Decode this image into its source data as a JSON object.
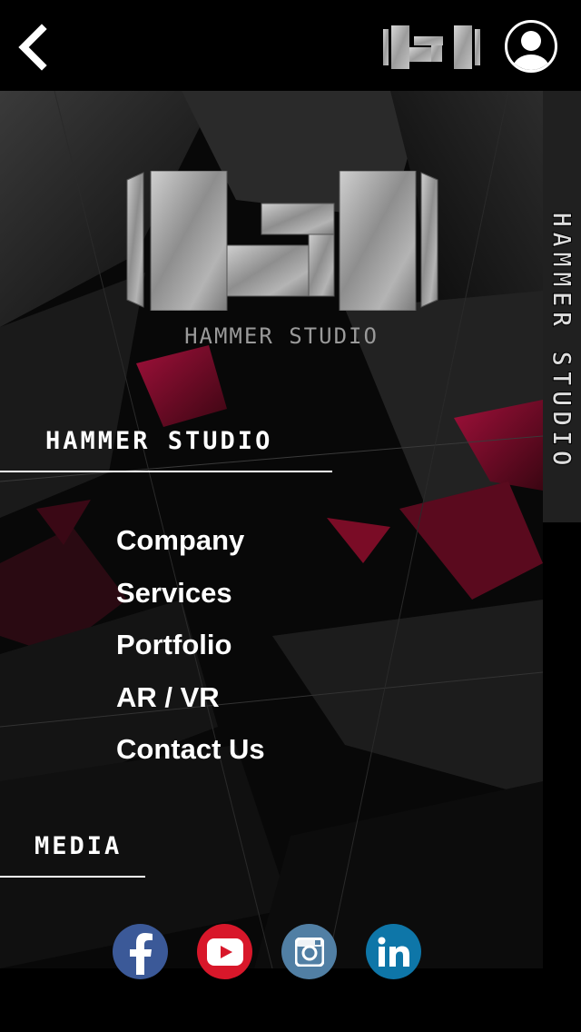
{
  "header": {
    "back_icon": "chevron-left-icon",
    "logo_icon": "hammer-studio-logo",
    "profile_icon": "user-profile-icon"
  },
  "brand": {
    "logo_caption": "HAMMER STUDIO",
    "side_title": "HAMMER STUDIO"
  },
  "sections": {
    "studio_title": "HAMMER STUDIO",
    "media_title": "MEDIA"
  },
  "menu": {
    "items": [
      {
        "label": "Company"
      },
      {
        "label": "Services"
      },
      {
        "label": "Portfolio"
      },
      {
        "label": "AR / VR"
      },
      {
        "label": "Contact Us"
      }
    ]
  },
  "social": {
    "items": [
      {
        "name": "facebook",
        "icon": "facebook-icon",
        "color": "#3b5998"
      },
      {
        "name": "youtube",
        "icon": "youtube-icon",
        "color": "#d8172a"
      },
      {
        "name": "instagram",
        "icon": "instagram-icon",
        "color": "#517fa4"
      },
      {
        "name": "linkedin",
        "icon": "linkedin-icon",
        "color": "#0e76a8"
      }
    ]
  },
  "colors": {
    "background": "#000000",
    "accent_red": "#8a0f2a",
    "text": "#ffffff",
    "logo_grey": "#9a9a9a"
  }
}
